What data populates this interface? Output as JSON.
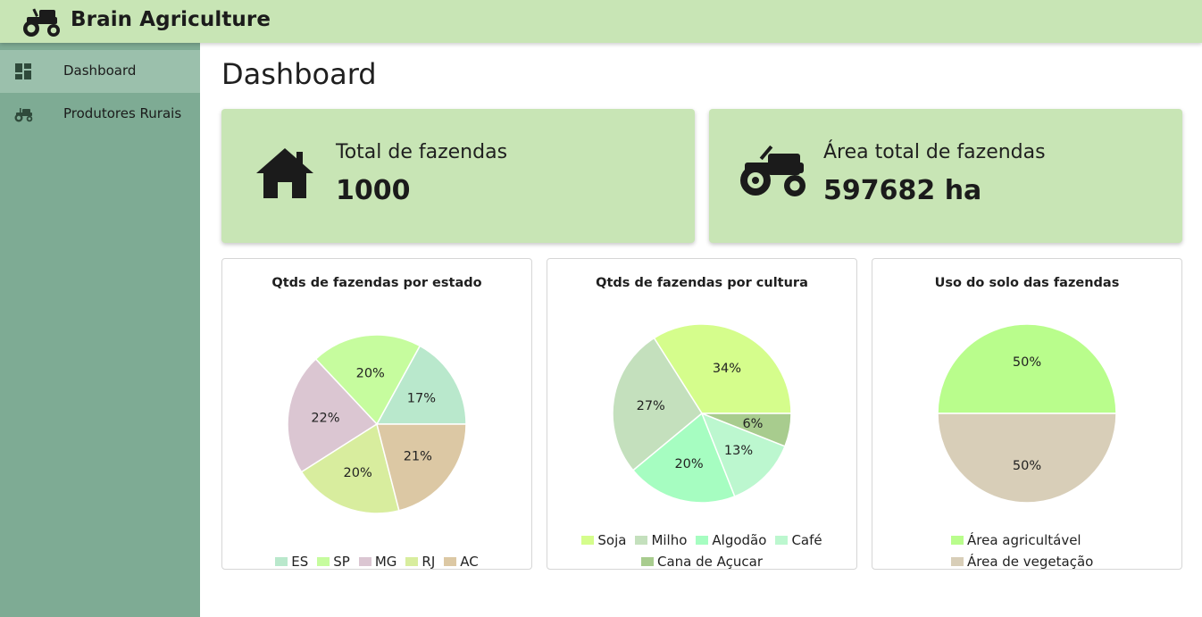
{
  "header": {
    "title": "Brain Agriculture",
    "logo_icon": "tractor-icon",
    "bg": "#c8e5b5"
  },
  "sidebar": {
    "bg": "#7eab94",
    "items": [
      {
        "label": "Dashboard",
        "icon": "dashboard-icon",
        "active": true
      },
      {
        "label": "Produtores Rurais",
        "icon": "tractor-icon",
        "active": false
      }
    ]
  },
  "main": {
    "title": "Dashboard",
    "stats": [
      {
        "label": "Total de fazendas",
        "value": "1000",
        "icon": "house-icon"
      },
      {
        "label": "Área total de fazendas",
        "value": "597682 ha",
        "icon": "tractor-icon"
      }
    ]
  },
  "chart_data": [
    {
      "type": "pie",
      "title": "Qtds de fazendas por estado",
      "categories": [
        "ES",
        "SP",
        "MG",
        "RJ",
        "AC"
      ],
      "values": [
        17,
        20,
        22,
        20,
        21
      ],
      "labels": [
        "17%",
        "20%",
        "22%",
        "20%",
        "21%"
      ],
      "colors": [
        "#b9e8cc",
        "#c6fc9e",
        "#dbc6d2",
        "#d8ed9e",
        "#dcc8a4"
      ],
      "legend_position": "bottom"
    },
    {
      "type": "pie",
      "title": "Qtds de fazendas por cultura",
      "categories": [
        "Soja",
        "Milho",
        "Algodão",
        "Café",
        "Cana de Açucar"
      ],
      "values": [
        34,
        27,
        20,
        13,
        6
      ],
      "labels": [
        "34%",
        "27%",
        "20%",
        "13%",
        "6%"
      ],
      "colors": [
        "#d5fd8c",
        "#c4e0bd",
        "#a6fdc1",
        "#bcf7cf",
        "#a8cc8e"
      ],
      "legend_position": "bottom"
    },
    {
      "type": "pie",
      "title": "Uso do solo das fazendas",
      "categories": [
        "Área agricultável",
        "Área de vegetação"
      ],
      "values": [
        50,
        50
      ],
      "labels": [
        "50%",
        "50%"
      ],
      "colors": [
        "#b9fd8c",
        "#d8ceb8"
      ],
      "legend_position": "bottom"
    }
  ]
}
